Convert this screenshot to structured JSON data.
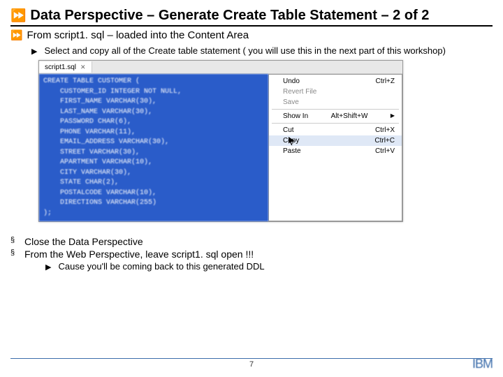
{
  "title": "Data Perspective – Generate Create Table Statement – 2 of 2",
  "sub1": "From script1. sql – loaded into the Content Area",
  "sub2": "Select and copy all of the Create table statement ( you will use this in the next part of this workshop)",
  "editor": {
    "tab": "script1.sql",
    "code_lines": [
      "CREATE TABLE CUSTOMER (",
      "    CUSTOMER_ID INTEGER NOT NULL,",
      "    FIRST_NAME VARCHAR(30),",
      "    LAST_NAME VARCHAR(30),",
      "    PASSWORD CHAR(6),",
      "    PHONE VARCHAR(11),",
      "    EMAIL_ADDRESS VARCHAR(30),",
      "    STREET VARCHAR(30),",
      "    APARTMENT VARCHAR(10),",
      "    CITY VARCHAR(30),",
      "    STATE CHAR(2),",
      "    POSTALCODE VARCHAR(10),",
      "    DIRECTIONS VARCHAR(255)",
      ");"
    ]
  },
  "ctx": {
    "undo": {
      "label": "Undo",
      "short": "Ctrl+Z"
    },
    "revert": {
      "label": "Revert File",
      "short": ""
    },
    "save": {
      "label": "Save",
      "short": ""
    },
    "showin": {
      "label": "Show In",
      "short": "Alt+Shift+W"
    },
    "cut": {
      "label": "Cut",
      "short": "Ctrl+X"
    },
    "copy": {
      "label": "Copy",
      "short": "Ctrl+C"
    },
    "paste": {
      "label": "Paste",
      "short": "Ctrl+V"
    }
  },
  "bullets": {
    "b1": "Close the Data Perspective",
    "b2": "From the Web Perspective, leave script1. sql open !!!",
    "b2a": "Cause you'll be coming back to this generated DDL"
  },
  "page": "7",
  "logo": "IBM"
}
